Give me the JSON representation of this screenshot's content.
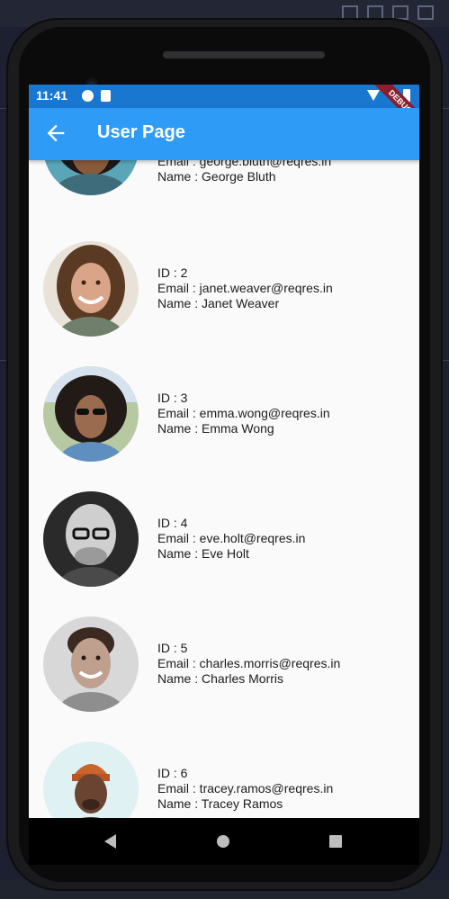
{
  "status_bar": {
    "time": "11:41",
    "debug_banner": "DEBUG"
  },
  "app_bar": {
    "title": "User Page"
  },
  "users": [
    {
      "email_line": "Email : george.bluth@reqres.in",
      "name_line": "Name : George Bluth"
    },
    {
      "id_line": "ID : 2",
      "email_line": "Email : janet.weaver@reqres.in",
      "name_line": "Name : Janet Weaver"
    },
    {
      "id_line": "ID : 3",
      "email_line": "Email : emma.wong@reqres.in",
      "name_line": "Name : Emma Wong"
    },
    {
      "id_line": "ID : 4",
      "email_line": "Email : eve.holt@reqres.in",
      "name_line": "Name : Eve Holt"
    },
    {
      "id_line": "ID : 5",
      "email_line": "Email : charles.morris@reqres.in",
      "name_line": "Name : Charles Morris"
    },
    {
      "id_line": "ID : 6",
      "email_line": "Email : tracey.ramos@reqres.in",
      "name_line": "Name : Tracey Ramos"
    }
  ],
  "icons": {
    "back": "arrow-back-icon",
    "nav_back": "triangle-back-icon",
    "nav_home": "circle-home-icon",
    "nav_recent": "square-recents-icon"
  },
  "colors": {
    "status_bar": "#1977d0",
    "app_bar": "#2e9cf6",
    "list_background": "#fafafa",
    "debug_ribbon": "#8a1f2e"
  }
}
